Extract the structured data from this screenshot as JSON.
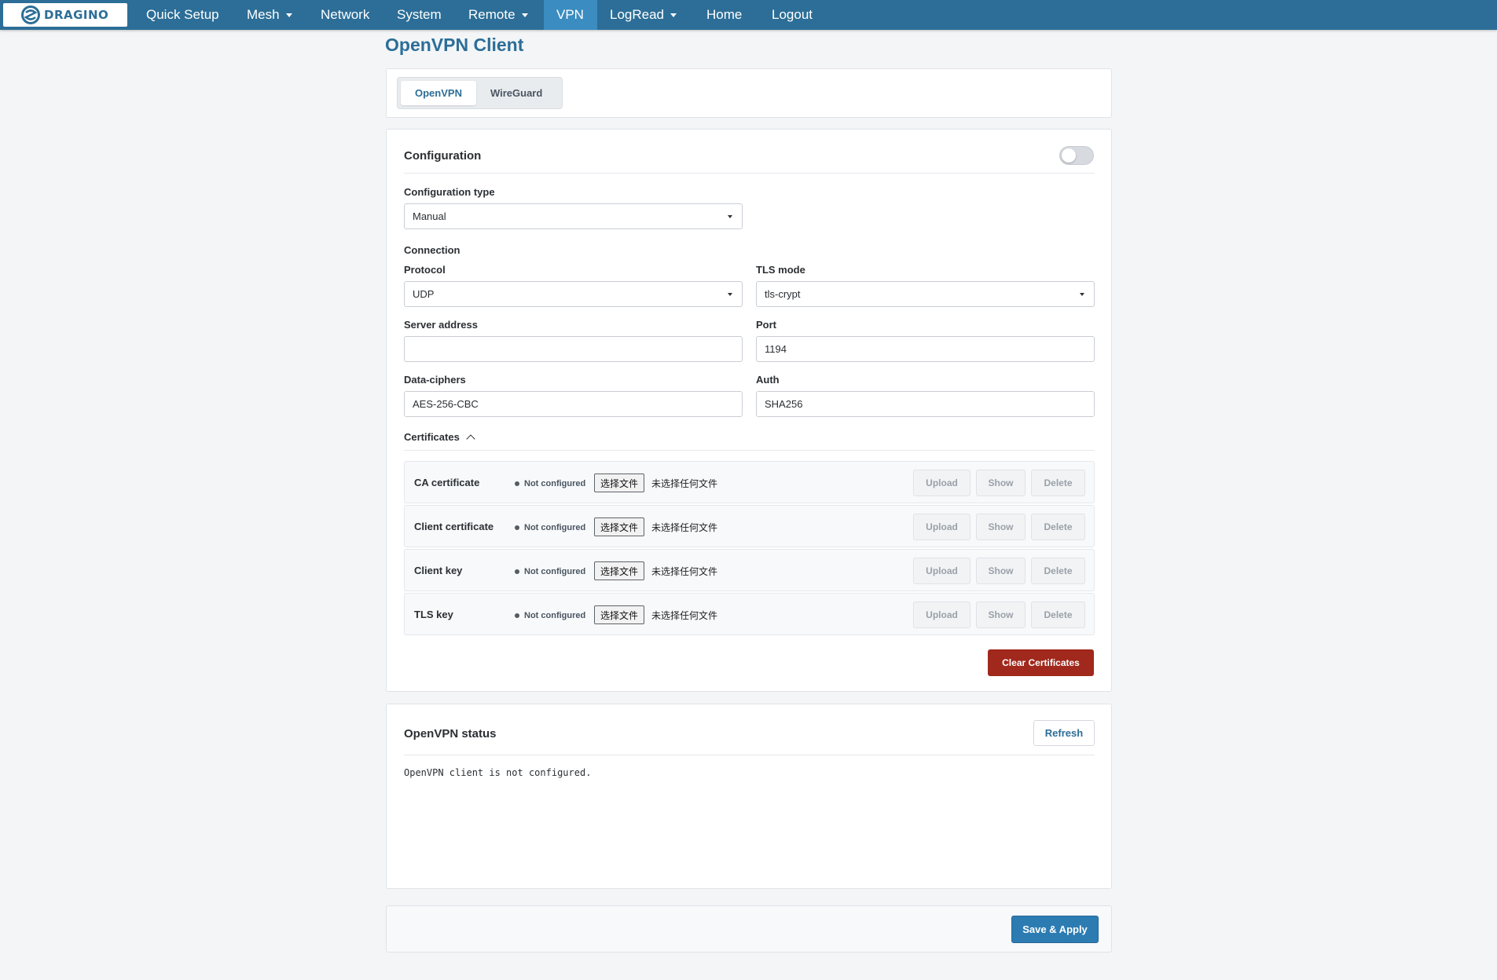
{
  "navbar": {
    "brand": "DRAGINO",
    "items": [
      {
        "label": "Quick Setup"
      },
      {
        "label": "Mesh"
      },
      {
        "label": "Network"
      },
      {
        "label": "System"
      },
      {
        "label": "Remote"
      },
      {
        "label": "VPN"
      },
      {
        "label": "LogRead"
      },
      {
        "label": "Home"
      },
      {
        "label": "Logout"
      }
    ]
  },
  "page_title": "OpenVPN Client",
  "tabs": [
    {
      "label": "OpenVPN"
    },
    {
      "label": "WireGuard"
    }
  ],
  "config": {
    "title": "Configuration",
    "enabled": false,
    "config_type_label": "Configuration type",
    "config_type_value": "Manual",
    "connection_label": "Connection",
    "protocol_label": "Protocol",
    "protocol_value": "UDP",
    "tls_mode_label": "TLS mode",
    "tls_mode_value": "tls-crypt",
    "server_label": "Server address",
    "server_value": "",
    "port_label": "Port",
    "port_value": "1194",
    "ciphers_label": "Data-ciphers",
    "ciphers_value": "AES-256-CBC",
    "auth_label": "Auth",
    "auth_value": "SHA256",
    "certificates_label": "Certificates"
  },
  "certificates": [
    {
      "name": "CA certificate",
      "status": "Not configured",
      "choose": "选择文件",
      "no_file": "未选择任何文件"
    },
    {
      "name": "Client certificate",
      "status": "Not configured",
      "choose": "选择文件",
      "no_file": "未选择任何文件"
    },
    {
      "name": "Client key",
      "status": "Not configured",
      "choose": "选择文件",
      "no_file": "未选择任何文件"
    },
    {
      "name": "TLS key",
      "status": "Not configured",
      "choose": "选择文件",
      "no_file": "未选择任何文件"
    }
  ],
  "cert_buttons": {
    "upload": "Upload",
    "show": "Show",
    "delete": "Delete"
  },
  "clear_certificates": "Clear Certificates",
  "status": {
    "title": "OpenVPN status",
    "refresh": "Refresh",
    "message": "OpenVPN client is not configured."
  },
  "footer": {
    "save_apply": "Save & Apply"
  },
  "colors": {
    "brand": "#2c6e97",
    "nav_active": "#3b8cc0",
    "danger": "#a0281c",
    "primary": "#2c7cb2"
  }
}
